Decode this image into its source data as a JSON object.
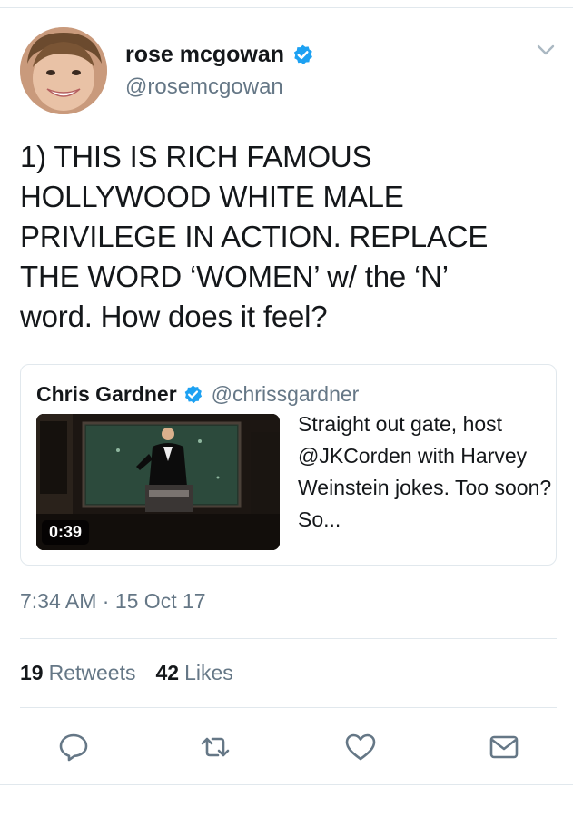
{
  "tweet": {
    "author": {
      "display_name": "rose mcgowan",
      "handle": "@rosemcgowan",
      "verified": true
    },
    "text": "1) THIS IS RICH FAMOUS\nHOLLYWOOD WHITE MALE\nPRIVILEGE IN ACTION. REPLACE\nTHE WORD ‘WOMEN’ w/ the ‘N’\nword. How does it feel?",
    "quoted": {
      "display_name": "Chris Gardner",
      "handle": "@chrissgardner",
      "verified": true,
      "text": "Straight out gate, host @JKCorden with Harvey Weinstein jokes. Too soon? So...",
      "video_duration": "0:39"
    },
    "timestamp": "7:34 AM · 15 Oct 17",
    "stats": {
      "retweets_count": "19",
      "retweets_label": "Retweets",
      "likes_count": "42",
      "likes_label": "Likes"
    }
  },
  "icons": {
    "verified": "verified-badge-icon",
    "menu": "chevron-down-icon",
    "reply": "reply-icon",
    "retweet": "retweet-icon",
    "like": "heart-icon",
    "dm": "envelope-icon"
  },
  "colors": {
    "verified_blue": "#1da1f2",
    "secondary_text": "#657786",
    "primary_text": "#14171a",
    "divider": "#e1e8ed"
  }
}
